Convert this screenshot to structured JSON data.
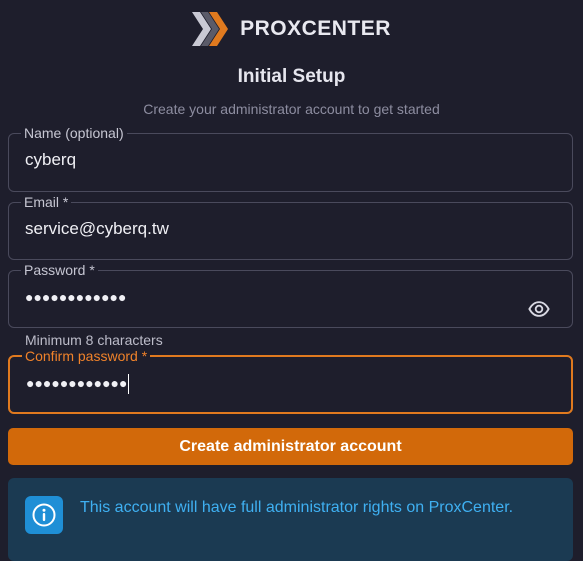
{
  "brand": {
    "name": "PROXCENTER",
    "logo_icon": "proxcenter-x-logo",
    "colors": {
      "light": "#c9c9d4",
      "accent": "#e07a1f"
    }
  },
  "setup": {
    "title": "Initial Setup",
    "subtitle": "Create your administrator account to get started"
  },
  "form": {
    "name": {
      "label": "Name (optional)",
      "value": "cyberq"
    },
    "email": {
      "label": "Email *",
      "value": "service@cyberq.tw"
    },
    "password": {
      "label": "Password *",
      "value": "●●●●●●●●●●●●",
      "hint": "Minimum 8 characters",
      "toggle_icon": "eye-icon"
    },
    "confirm_password": {
      "label": "Confirm password *",
      "value": "●●●●●●●●●●●●",
      "focused": true
    },
    "submit_label": "Create administrator account"
  },
  "info": {
    "icon": "info-icon",
    "text": "This account will have full administrator rights on ProxCenter."
  },
  "colors": {
    "background": "#1e1e2c",
    "accent": "#d2690a",
    "info_bg": "#1b3a52",
    "info_text": "#3fb0f2"
  }
}
